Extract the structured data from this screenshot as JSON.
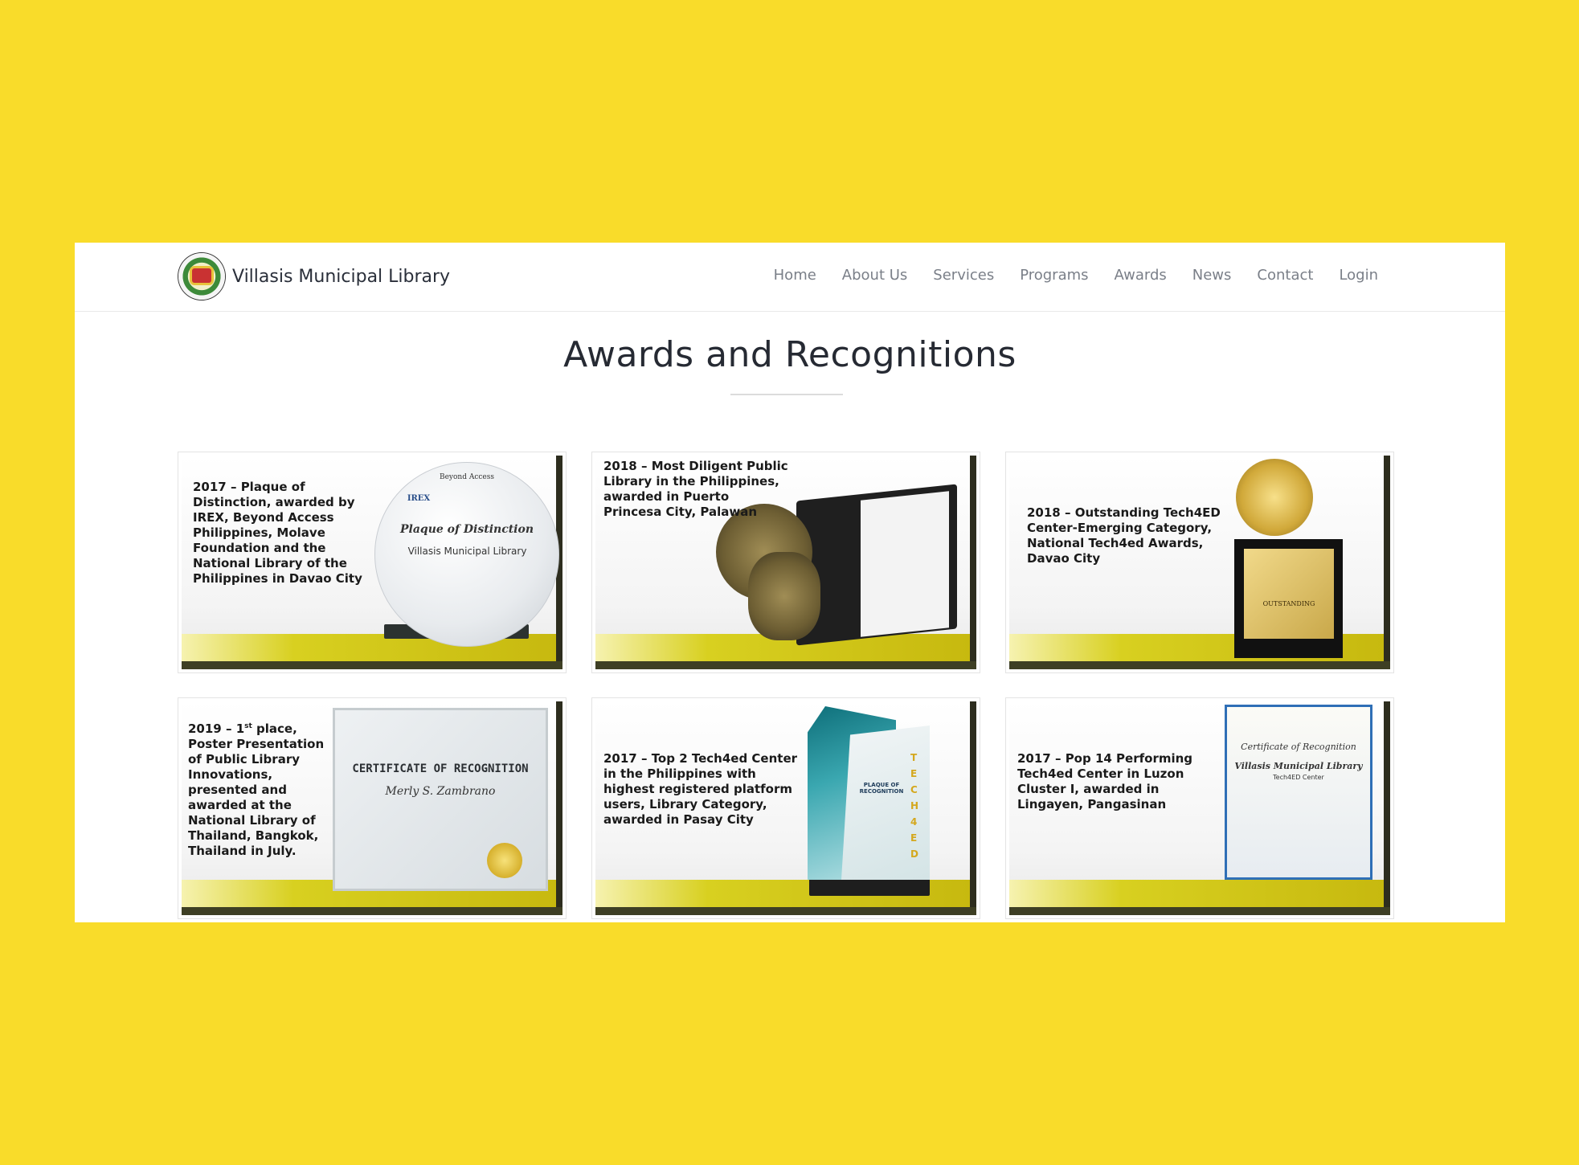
{
  "brand": {
    "name": "Villasis Municipal Library"
  },
  "nav": {
    "items": [
      "Home",
      "About Us",
      "Services",
      "Programs",
      "Awards",
      "News",
      "Contact",
      "Login"
    ]
  },
  "page": {
    "title": "Awards and Recognitions"
  },
  "awards": [
    {
      "caption": "2017 – Plaque of Distinction, awarded by IREX, Beyond Access Philippines, Molave Foundation and the National Library of the Philippines in Davao City",
      "plaque_header": "Beyond Access",
      "plaque_logo": "IREX",
      "plaque_title": "Plaque of Distinction",
      "plaque_recipient": "Villasis Municipal Library"
    },
    {
      "caption": "2018 – Most Diligent Public Library in the Philippines, awarded in Puerto Princesa City, Palawan"
    },
    {
      "caption": "2018 – Outstanding Tech4ED Center-Emerging Category, National Tech4ed Awards, Davao City",
      "plate_title": "OUTSTANDING"
    },
    {
      "caption_prefix": "2019 – 1",
      "caption_sup": "st",
      "caption_rest": " place, Poster Presentation of Public Library Innovations, presented and awarded at the National Library of Thailand, Bangkok, Thailand in July.",
      "cert_title": "CERTIFICATE OF RECOGNITION",
      "cert_name": "Merly S. Zambrano"
    },
    {
      "caption": "2017 – Top 2 Tech4ed Center in the Philippines with highest registered platform users, Library Category, awarded in Pasay City",
      "plaque_title": "PLAQUE OF RECOGNITION",
      "plaque_side": "TECH4ED"
    },
    {
      "caption": "2017 – Pop 14 Performing Tech4ed Center in Luzon Cluster I, awarded in Lingayen, Pangasinan",
      "cert_title": "Certificate of Recognition",
      "cert_name": "Villasis Municipal Library",
      "cert_sub": "Tech4ED Center"
    }
  ],
  "colors": {
    "background": "#f9dc2a",
    "band": "#c7b90f"
  }
}
